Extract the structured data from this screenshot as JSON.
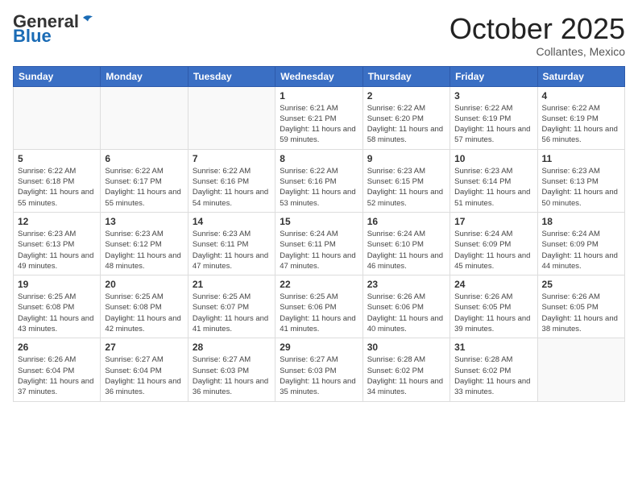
{
  "header": {
    "logo_general": "General",
    "logo_blue": "Blue",
    "month_title": "October 2025",
    "location": "Collantes, Mexico"
  },
  "days_of_week": [
    "Sunday",
    "Monday",
    "Tuesday",
    "Wednesday",
    "Thursday",
    "Friday",
    "Saturday"
  ],
  "weeks": [
    [
      {
        "num": "",
        "info": ""
      },
      {
        "num": "",
        "info": ""
      },
      {
        "num": "",
        "info": ""
      },
      {
        "num": "1",
        "info": "Sunrise: 6:21 AM\nSunset: 6:21 PM\nDaylight: 11 hours and 59 minutes."
      },
      {
        "num": "2",
        "info": "Sunrise: 6:22 AM\nSunset: 6:20 PM\nDaylight: 11 hours and 58 minutes."
      },
      {
        "num": "3",
        "info": "Sunrise: 6:22 AM\nSunset: 6:19 PM\nDaylight: 11 hours and 57 minutes."
      },
      {
        "num": "4",
        "info": "Sunrise: 6:22 AM\nSunset: 6:19 PM\nDaylight: 11 hours and 56 minutes."
      }
    ],
    [
      {
        "num": "5",
        "info": "Sunrise: 6:22 AM\nSunset: 6:18 PM\nDaylight: 11 hours and 55 minutes."
      },
      {
        "num": "6",
        "info": "Sunrise: 6:22 AM\nSunset: 6:17 PM\nDaylight: 11 hours and 55 minutes."
      },
      {
        "num": "7",
        "info": "Sunrise: 6:22 AM\nSunset: 6:16 PM\nDaylight: 11 hours and 54 minutes."
      },
      {
        "num": "8",
        "info": "Sunrise: 6:22 AM\nSunset: 6:16 PM\nDaylight: 11 hours and 53 minutes."
      },
      {
        "num": "9",
        "info": "Sunrise: 6:23 AM\nSunset: 6:15 PM\nDaylight: 11 hours and 52 minutes."
      },
      {
        "num": "10",
        "info": "Sunrise: 6:23 AM\nSunset: 6:14 PM\nDaylight: 11 hours and 51 minutes."
      },
      {
        "num": "11",
        "info": "Sunrise: 6:23 AM\nSunset: 6:13 PM\nDaylight: 11 hours and 50 minutes."
      }
    ],
    [
      {
        "num": "12",
        "info": "Sunrise: 6:23 AM\nSunset: 6:13 PM\nDaylight: 11 hours and 49 minutes."
      },
      {
        "num": "13",
        "info": "Sunrise: 6:23 AM\nSunset: 6:12 PM\nDaylight: 11 hours and 48 minutes."
      },
      {
        "num": "14",
        "info": "Sunrise: 6:23 AM\nSunset: 6:11 PM\nDaylight: 11 hours and 47 minutes."
      },
      {
        "num": "15",
        "info": "Sunrise: 6:24 AM\nSunset: 6:11 PM\nDaylight: 11 hours and 47 minutes."
      },
      {
        "num": "16",
        "info": "Sunrise: 6:24 AM\nSunset: 6:10 PM\nDaylight: 11 hours and 46 minutes."
      },
      {
        "num": "17",
        "info": "Sunrise: 6:24 AM\nSunset: 6:09 PM\nDaylight: 11 hours and 45 minutes."
      },
      {
        "num": "18",
        "info": "Sunrise: 6:24 AM\nSunset: 6:09 PM\nDaylight: 11 hours and 44 minutes."
      }
    ],
    [
      {
        "num": "19",
        "info": "Sunrise: 6:25 AM\nSunset: 6:08 PM\nDaylight: 11 hours and 43 minutes."
      },
      {
        "num": "20",
        "info": "Sunrise: 6:25 AM\nSunset: 6:08 PM\nDaylight: 11 hours and 42 minutes."
      },
      {
        "num": "21",
        "info": "Sunrise: 6:25 AM\nSunset: 6:07 PM\nDaylight: 11 hours and 41 minutes."
      },
      {
        "num": "22",
        "info": "Sunrise: 6:25 AM\nSunset: 6:06 PM\nDaylight: 11 hours and 41 minutes."
      },
      {
        "num": "23",
        "info": "Sunrise: 6:26 AM\nSunset: 6:06 PM\nDaylight: 11 hours and 40 minutes."
      },
      {
        "num": "24",
        "info": "Sunrise: 6:26 AM\nSunset: 6:05 PM\nDaylight: 11 hours and 39 minutes."
      },
      {
        "num": "25",
        "info": "Sunrise: 6:26 AM\nSunset: 6:05 PM\nDaylight: 11 hours and 38 minutes."
      }
    ],
    [
      {
        "num": "26",
        "info": "Sunrise: 6:26 AM\nSunset: 6:04 PM\nDaylight: 11 hours and 37 minutes."
      },
      {
        "num": "27",
        "info": "Sunrise: 6:27 AM\nSunset: 6:04 PM\nDaylight: 11 hours and 36 minutes."
      },
      {
        "num": "28",
        "info": "Sunrise: 6:27 AM\nSunset: 6:03 PM\nDaylight: 11 hours and 36 minutes."
      },
      {
        "num": "29",
        "info": "Sunrise: 6:27 AM\nSunset: 6:03 PM\nDaylight: 11 hours and 35 minutes."
      },
      {
        "num": "30",
        "info": "Sunrise: 6:28 AM\nSunset: 6:02 PM\nDaylight: 11 hours and 34 minutes."
      },
      {
        "num": "31",
        "info": "Sunrise: 6:28 AM\nSunset: 6:02 PM\nDaylight: 11 hours and 33 minutes."
      },
      {
        "num": "",
        "info": ""
      }
    ]
  ]
}
